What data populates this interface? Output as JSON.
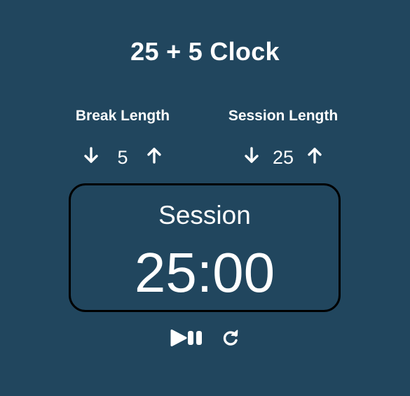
{
  "app": {
    "title": "25 + 5 Clock"
  },
  "break_control": {
    "label": "Break Length",
    "value": "5",
    "decrement_icon": "arrow-down-icon",
    "increment_icon": "arrow-up-icon"
  },
  "session_control": {
    "label": "Session Length",
    "value": "25",
    "decrement_icon": "arrow-down-icon",
    "increment_icon": "arrow-up-icon"
  },
  "timer": {
    "label": "Session",
    "time_left": "25:00"
  },
  "playback": {
    "play_pause_icon": "play-pause-icon",
    "reset_icon": "refresh-icon"
  },
  "colors": {
    "background": "#21465e",
    "text": "#ffffff",
    "timer_border": "#000000"
  }
}
